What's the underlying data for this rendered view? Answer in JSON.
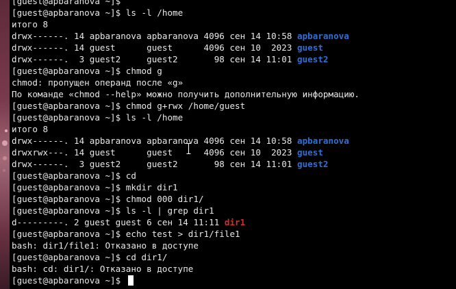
{
  "terminal": {
    "lines": [
      [
        {
          "t": "[guest@apbaranova ~]$ "
        }
      ],
      [
        {
          "t": "[guest@apbaranova ~]$ ls -l /home"
        }
      ],
      [
        {
          "t": "итого 8"
        }
      ],
      [
        {
          "t": "drwx------. 14 apbaranova apbaranova 4096 сен 14 10:58 "
        },
        {
          "t": "apbaranova",
          "c": "blue"
        }
      ],
      [
        {
          "t": "drwx------. 14 guest      guest      4096 сен 10  2023 "
        },
        {
          "t": "guest",
          "c": "blue"
        }
      ],
      [
        {
          "t": "drwx------.  3 guest2     guest2       98 сен 14 11:01 "
        },
        {
          "t": "guest2",
          "c": "blue"
        }
      ],
      [
        {
          "t": "[guest@apbaranova ~]$ chmod g"
        }
      ],
      [
        {
          "t": "chmod: пропущен операнд после «g»"
        }
      ],
      [
        {
          "t": "По команде «chmod --help» можно получить дополнительную информацию."
        }
      ],
      [
        {
          "t": "[guest@apbaranova ~]$ chmod g+rwx /home/guest"
        }
      ],
      [
        {
          "t": "[guest@apbaranova ~]$ ls -l /home"
        }
      ],
      [
        {
          "t": "итого 8"
        }
      ],
      [
        {
          "t": "drwx------. 14 apbaranova apbaranova 4096 сен 14 10:58 "
        },
        {
          "t": "apbaranova",
          "c": "blue"
        }
      ],
      [
        {
          "t": "drwxrwx---. 14 guest      guest      4096 сен 10  2023 "
        },
        {
          "t": "guest",
          "c": "blue"
        }
      ],
      [
        {
          "t": "drwx------.  3 guest2     guest2       98 сен 14 11:01 "
        },
        {
          "t": "guest2",
          "c": "blue"
        }
      ],
      [
        {
          "t": "[guest@apbaranova ~]$ cd"
        }
      ],
      [
        {
          "t": "[guest@apbaranova ~]$ mkdir dir1"
        }
      ],
      [
        {
          "t": "[guest@apbaranova ~]$ chmod 000 dir1/"
        }
      ],
      [
        {
          "t": "[guest@apbaranova ~]$ ls -l | grep dir1"
        }
      ],
      [
        {
          "t": "d---------. 2 guest guest 6 сен 14 11:11 "
        },
        {
          "t": "dir1",
          "c": "red"
        }
      ],
      [
        {
          "t": "[guest@apbaranova ~]$ echo test > dir1/file1"
        }
      ],
      [
        {
          "t": "bash: dir1/file1: Отказано в доступе"
        }
      ],
      [
        {
          "t": "[guest@apbaranova ~]$ cd dir1/"
        }
      ],
      [
        {
          "t": "bash: cd: dir1/: Отказано в доступе"
        }
      ],
      [
        {
          "t": "[guest@apbaranova ~]$ ",
          "cursor": true
        }
      ]
    ]
  },
  "colors": {
    "background": "#000000",
    "foreground": "#e8e8e8",
    "directory": "#2f6fd6",
    "no_permission_dir": "#d3302a"
  },
  "icons": {
    "pointer": "text-cursor-icon"
  }
}
